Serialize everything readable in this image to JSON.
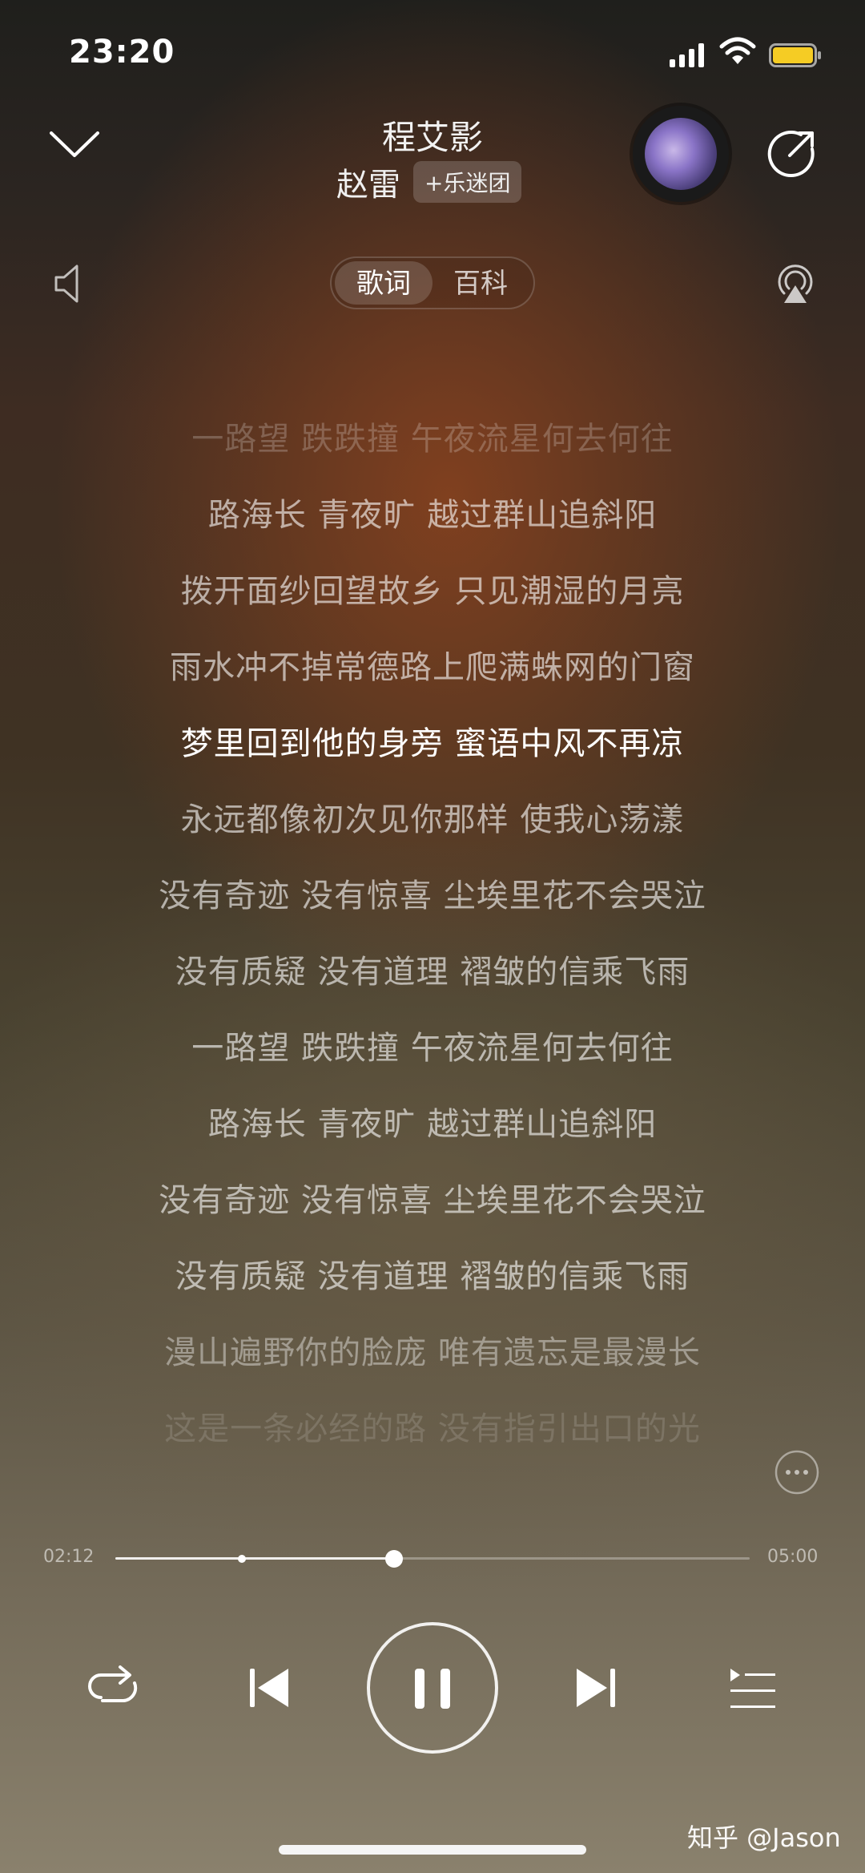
{
  "status_bar": {
    "time": "23:20"
  },
  "header": {
    "song_title": "程艾影",
    "artist": "赵雷",
    "fan_group_label": "+乐迷团"
  },
  "tabs": [
    {
      "label": "歌词",
      "active": true
    },
    {
      "label": "百科",
      "active": false
    }
  ],
  "lyrics": {
    "current_index": 4,
    "lines": [
      "一路望 跌跌撞 午夜流星何去何往",
      "路海长 青夜旷 越过群山追斜阳",
      "拨开面纱回望故乡 只见潮湿的月亮",
      "雨水冲不掉常德路上爬满蛛网的门窗",
      "梦里回到他的身旁 蜜语中风不再凉",
      "永远都像初次见你那样 使我心荡漾",
      "没有奇迹 没有惊喜 尘埃里花不会哭泣",
      "没有质疑 没有道理 褶皱的信乘飞雨",
      "一路望 跌跌撞 午夜流星何去何往",
      "路海长 青夜旷 越过群山追斜阳",
      "没有奇迹 没有惊喜 尘埃里花不会哭泣",
      "没有质疑 没有道理 褶皱的信乘飞雨",
      "漫山遍野你的脸庞 唯有遗忘是最漫长",
      "这是一条必经的路 没有指引出口的光"
    ]
  },
  "player": {
    "current_time": "02:12",
    "total_time": "05:00",
    "progress": 0.44,
    "buffered": 0.2
  },
  "watermark": "知乎 @Jason",
  "colors": {
    "background_warm": "#3f3223",
    "accent": "#ffffff"
  }
}
